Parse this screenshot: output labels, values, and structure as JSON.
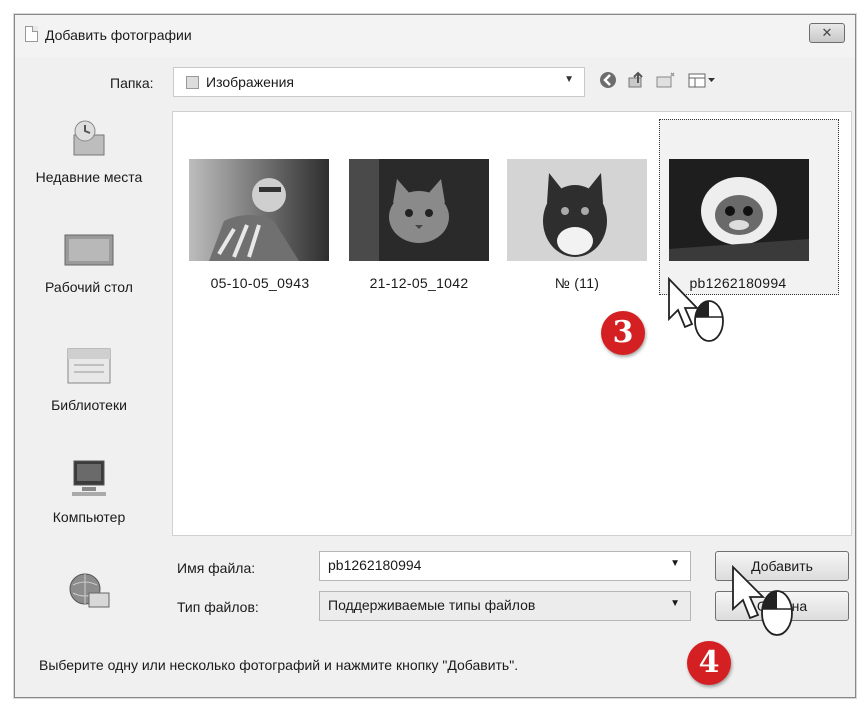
{
  "window": {
    "title": "Добавить фотографии",
    "close_glyph": "✕"
  },
  "folder": {
    "label": "Папка:",
    "value": "Изображения"
  },
  "toolbar_icons": [
    "back-icon",
    "up-folder-icon",
    "new-folder-icon",
    "view-menu-icon"
  ],
  "places": [
    {
      "label": "Недавние места",
      "icon": "recent-places-icon"
    },
    {
      "label": "Рабочий стол",
      "icon": "desktop-icon"
    },
    {
      "label": "Библиотеки",
      "icon": "libraries-icon"
    },
    {
      "label": "Компьютер",
      "icon": "computer-icon"
    },
    {
      "label": "",
      "icon": "network-icon"
    }
  ],
  "files": [
    {
      "name": "05-10-05_0943"
    },
    {
      "name": "21-12-05_1042"
    },
    {
      "name": "№ (11)"
    },
    {
      "name": "pb1262180994",
      "selected": true
    }
  ],
  "filename": {
    "label": "Имя файла:",
    "value": "pb1262180994"
  },
  "filetype": {
    "label": "Тип файлов:",
    "value": "Поддерживаемые типы файлов"
  },
  "buttons": {
    "add": "Добавить",
    "cancel": "Отмена"
  },
  "status": "Выберите одну или несколько фотографий и нажмите кнопку \"Добавить\".",
  "annotations": {
    "step3": "3",
    "step4": "4"
  },
  "colors": {
    "badge": "#d42022",
    "window_bg": "#f0f0f0"
  }
}
